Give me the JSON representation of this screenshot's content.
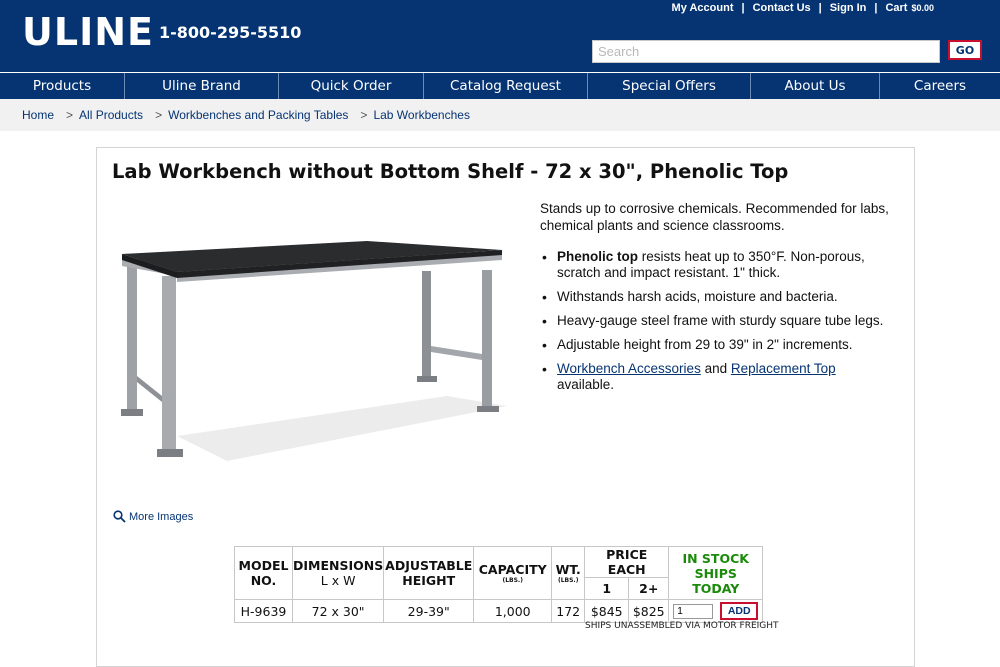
{
  "header": {
    "logo": "ULINE",
    "phone": "1-800-295-5510",
    "links": [
      "My Account",
      "Contact Us",
      "Sign In",
      "Cart"
    ],
    "cart_total": "$0.00",
    "search_placeholder": "Search",
    "go_label": "GO"
  },
  "nav": [
    "Products",
    "Uline Brand",
    "Quick Order",
    "Catalog Request",
    "Special Offers",
    "About Us",
    "Careers"
  ],
  "breadcrumb": [
    "Home",
    "All Products",
    "Workbenches and Packing Tables",
    "Lab Workbenches"
  ],
  "product": {
    "title": "Lab Workbench without Bottom Shelf - 72 x 30\", Phenolic Top",
    "description": "Stands up to corrosive chemicals. Recommended for labs, chemical plants and science classrooms.",
    "bullet1_bold": "Phenolic top",
    "bullet1_rest": " resists heat up to 350°F. Non-porous, scratch and impact resistant. 1\" thick.",
    "bullet2": "Withstands harsh acids, moisture and bacteria.",
    "bullet3": "Heavy-gauge steel frame with sturdy square tube legs.",
    "bullet4": "Adjustable height from 29 to 39\" in 2\" increments.",
    "bullet5_link1": "Workbench Accessories",
    "bullet5_and": " and ",
    "bullet5_link2": "Replacement Top",
    "bullet5_rest": " available.",
    "more_images": "More Images"
  },
  "table": {
    "headers": {
      "model": "MODEL NO.",
      "dimensions": "DIMENSIONS",
      "dimensions_sub": "L x W",
      "adjustable": "ADJUSTABLE",
      "adjustable_sub": "HEIGHT",
      "capacity": "CAPACITY",
      "capacity_unit": "(LBS.)",
      "wt": "WT.",
      "wt_unit": "(LBS.)",
      "price_each": "PRICE EACH",
      "price_1": "1",
      "price_2": "2+",
      "stock": "IN STOCK",
      "ships": "SHIPS TODAY"
    },
    "row": {
      "model": "H-9639",
      "dimensions": "72 x 30\"",
      "height": "29-39\"",
      "capacity": "1,000",
      "wt": "172",
      "price1": "$845",
      "price2": "$825",
      "qty": "1",
      "add_label": "ADD"
    },
    "note": "SHIPS UNASSEMBLED VIA MOTOR FREIGHT"
  }
}
